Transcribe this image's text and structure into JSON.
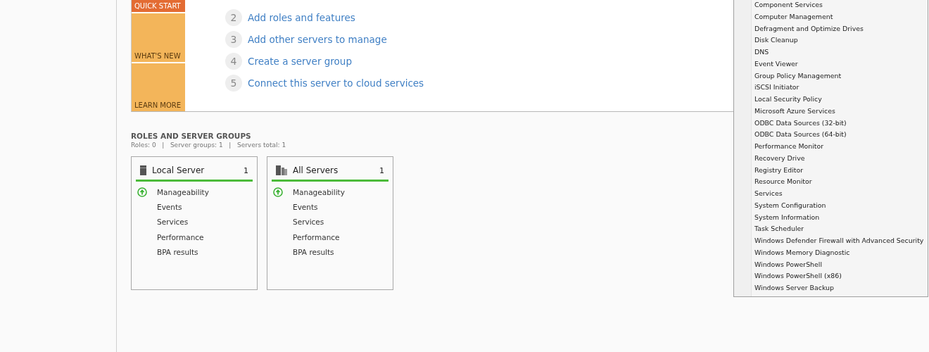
{
  "welcome": {
    "tiles": [
      {
        "label": "QUICK START",
        "selected": true
      },
      {
        "label": "WHAT'S NEW",
        "selected": false
      },
      {
        "label": "LEARN MORE",
        "selected": false
      }
    ],
    "steps": [
      {
        "number": "2",
        "label": "Add roles and features"
      },
      {
        "number": "3",
        "label": "Add other servers to manage"
      },
      {
        "number": "4",
        "label": "Create a server group"
      },
      {
        "number": "5",
        "label": "Connect this server to cloud services"
      }
    ]
  },
  "roles_and_server_groups": {
    "title": "ROLES AND SERVER GROUPS",
    "summary": "Roles: 0   |   Server groups: 1   |   Servers total: 1",
    "cards": [
      {
        "kind": "single",
        "title": "Local Server",
        "count": "1",
        "items": [
          {
            "kind": "status",
            "label": "Manageability"
          },
          {
            "kind": "plain",
            "label": "Events"
          },
          {
            "kind": "plain",
            "label": "Services"
          },
          {
            "kind": "plain",
            "label": "Performance"
          },
          {
            "kind": "plain",
            "label": "BPA results"
          }
        ]
      },
      {
        "kind": "group",
        "title": "All Servers",
        "count": "1",
        "items": [
          {
            "kind": "status",
            "label": "Manageability"
          },
          {
            "kind": "plain",
            "label": "Events"
          },
          {
            "kind": "plain",
            "label": "Services"
          },
          {
            "kind": "plain",
            "label": "Performance"
          },
          {
            "kind": "plain",
            "label": "BPA results"
          }
        ]
      }
    ]
  },
  "tools_menu": {
    "items": [
      "Component Services",
      "Computer Management",
      "Defragment and Optimize Drives",
      "Disk Cleanup",
      "DNS",
      "Event Viewer",
      "Group Policy Management",
      "iSCSI Initiator",
      "Local Security Policy",
      "Microsoft Azure Services",
      "ODBC Data Sources (32-bit)",
      "ODBC Data Sources (64-bit)",
      "Performance Monitor",
      "Recovery Drive",
      "Registry Editor",
      "Resource Monitor",
      "Services",
      "System Configuration",
      "System Information",
      "Task Scheduler",
      "Windows Defender Firewall with Advanced Security",
      "Windows Memory Diagnostic",
      "Windows PowerShell",
      "Windows PowerShell (x86)",
      "Windows Server Backup"
    ]
  }
}
